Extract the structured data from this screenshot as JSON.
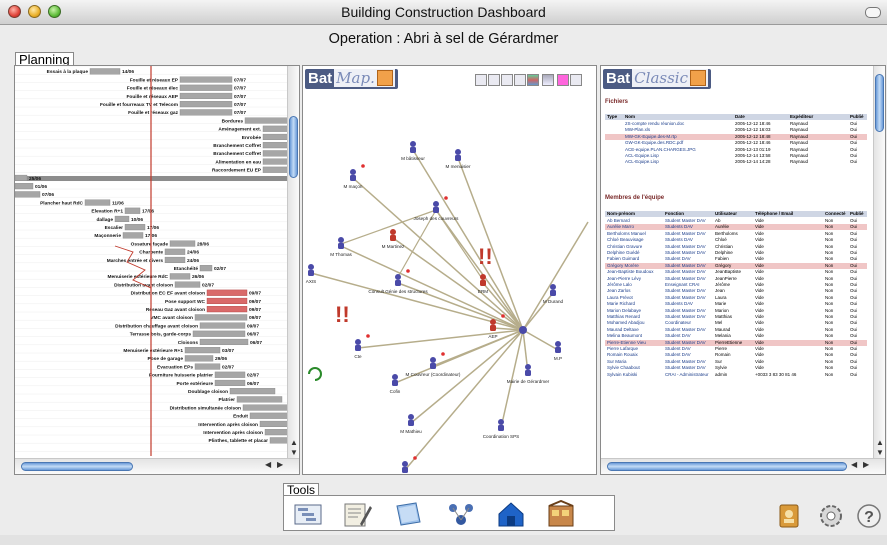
{
  "window": {
    "title": "Building Construction Dashboard"
  },
  "operation_title": "Operation : Abri à sel de Gérardmer",
  "planning": {
    "label": "Planning",
    "tasks": [
      {
        "name": "Essais à la plaque",
        "date": "14/06"
      },
      {
        "name": "Fouille et réseaux EP",
        "date": "07/07"
      },
      {
        "name": "Fouille et réseaux élec",
        "date": "07/07"
      },
      {
        "name": "Fouille et réseaux AEP",
        "date": "07/07"
      },
      {
        "name": "Fouille et fourreaux TV et Telecom",
        "date": "07/07"
      },
      {
        "name": "Fouille et réseaux gaz",
        "date": "07/07"
      },
      {
        "name": "Bordures",
        "date": "15/07"
      },
      {
        "name": "Aménagement ext.",
        "date": ""
      },
      {
        "name": "Enrobée",
        "date": ""
      },
      {
        "name": "Branchement Coffret",
        "date": ""
      },
      {
        "name": "Branchement Coffret",
        "date": ""
      },
      {
        "name": "Alimentation en eau",
        "date": ""
      },
      {
        "name": "Raccordement EU EP",
        "date": ""
      },
      {
        "name": "",
        "date": "25/06"
      },
      {
        "name": "",
        "date": "01/06"
      },
      {
        "name": "x pour dallage",
        "date": "07/06"
      },
      {
        "name": "Plancher haut RdC",
        "date": "11/06"
      },
      {
        "name": "Elevation R+1",
        "date": "17/06"
      },
      {
        "name": "dallage",
        "date": "10/06"
      },
      {
        "name": "Escalier",
        "date": "17/06"
      },
      {
        "name": "Maçonnerie",
        "date": "17/06"
      },
      {
        "name": "Ossature façade",
        "date": "28/06"
      },
      {
        "name": "Charpente",
        "date": "24/06"
      },
      {
        "name": "Marches entrée et divers",
        "date": "24/06"
      },
      {
        "name": "Etanchéité",
        "date": "02/07"
      },
      {
        "name": "Menuiserie extérieure RdC",
        "date": "26/06"
      },
      {
        "name": "Distribution avant cloison",
        "date": "02/07"
      },
      {
        "name": "Distribution EC EF avant cloison",
        "date": "09/07"
      },
      {
        "name": "Pose support WC",
        "date": "09/07"
      },
      {
        "name": "Réseau Gaz avant cloison",
        "date": "09/07"
      },
      {
        "name": "VMC avant cloison",
        "date": "09/07"
      },
      {
        "name": "Distribution chauffage avant cloison",
        "date": "09/07"
      },
      {
        "name": "Terrasse bois, garde-corps",
        "date": "06/07"
      },
      {
        "name": "Cloisons",
        "date": "06/07"
      },
      {
        "name": "Menuiserie extérieure R+1",
        "date": "03/07"
      },
      {
        "name": "Pose de garage",
        "date": "29/06"
      },
      {
        "name": "Evacuation EPs",
        "date": "02/07"
      },
      {
        "name": "Fourniture huisserie platrier",
        "date": "02/07"
      },
      {
        "name": "Porte extérieure",
        "date": "06/07"
      },
      {
        "name": "Doublage cloison",
        "date": ""
      },
      {
        "name": "Platrier",
        "date": ""
      },
      {
        "name": "Distribution simultanée cloison",
        "date": ""
      },
      {
        "name": "Enduit",
        "date": ""
      },
      {
        "name": "Intervention après cloison",
        "date": ""
      },
      {
        "name": "Intervention après cloison",
        "date": ""
      },
      {
        "name": "Plinthes, tablette et placar",
        "date": ""
      }
    ]
  },
  "batmap": {
    "logo_main": "Bat",
    "logo_sub": "Map.",
    "alerts": [
      "!!",
      "!!"
    ],
    "nodes": [
      "M maçon",
      "M bâtisseur",
      "M menuisier",
      "Joseph des couvreurs",
      "M Thomas",
      "M Martinez",
      "Consult Génie des structures",
      "ERM",
      "M Durand",
      "AEP",
      "M.P",
      "Mairie de Gérardmer",
      "M Couvreur (Coordinateur)",
      "Coordination SPS",
      "M Mathieu",
      "Cte",
      "Cofin",
      "AXIS",
      "M Dupont"
    ]
  },
  "batclassic": {
    "logo_main": "Bat",
    "logo_sub": "Classic",
    "files_title": "Fichiers",
    "files_headers": [
      "Type",
      "Nom",
      "Date",
      "Expéditeur",
      "Publié"
    ],
    "files": [
      [
        "",
        "2S-compte rendu réunion.doc",
        "2005-12-12 18:46",
        "Raynaud",
        "Oui"
      ],
      [
        "",
        "MW-Plan.xls",
        "2005-12-12 16:03",
        "Raynaud",
        "Oui"
      ],
      [
        "",
        "MW-GK-Equipe.des-M.rtp",
        "2005-12-12 18:48",
        "Raynaud",
        "Oui"
      ],
      [
        "",
        "GW-GK-Equipe.des.RDC.pdf",
        "2005-12-12 18:46",
        "Raynaud",
        "Oui"
      ],
      [
        "",
        "ACE-equipe.PLAN.CHARGES.JPG",
        "2005-12-13 01:19",
        "Raynaud",
        "Oui"
      ],
      [
        "",
        "ACL-Equipe.Lisp",
        "2005-12-14 13:58",
        "Raynaud",
        "Oui"
      ],
      [
        "",
        "ACL-Equipe.Lisp",
        "2005-12-14 14:28",
        "Raynaud",
        "Oui"
      ]
    ],
    "members_title": "Membres de l'équipe",
    "members_headers": [
      "Nom-prénom",
      "Fonction",
      "Utilisateur",
      "Téléphone / Email",
      "Connecté",
      "Publié"
    ],
    "members": [
      [
        "Ab Bernard",
        "Student Master DAV",
        "Ab",
        "Vide",
        "Non",
        "Oui"
      ],
      [
        "Aurélie Marro",
        "Students DAV",
        "Aurélie",
        "Vide",
        "Non",
        "Oui"
      ],
      [
        "Bertholoms Manuel",
        "Student Master DAV",
        "Bertholoms",
        "Vide",
        "Non",
        "Oui"
      ],
      [
        "Chloé Beauvisage",
        "Students DAV",
        "Chloé",
        "Vide",
        "Non",
        "Oui"
      ],
      [
        "Christian Gravure",
        "Student Master DAV",
        "Christian",
        "Vide",
        "Non",
        "Oui"
      ],
      [
        "Delphine Guédé",
        "Student Master DAV",
        "Delphine",
        "Vide",
        "Non",
        "Oui"
      ],
      [
        "Fabien Guimard",
        "Student DAV",
        "Fabien",
        "Vide",
        "Non",
        "Oui"
      ],
      [
        "Grégory Morère",
        "Student Master DAV",
        "Grégory",
        "Vide",
        "Non",
        "Oui"
      ],
      [
        "Jean-Baptiste Boudoux",
        "Student Master DAV",
        "JeanBaptiste",
        "Vide",
        "Non",
        "Oui"
      ],
      [
        "Jean-Pierre Lévy",
        "Student Master DAV",
        "JeanPierre",
        "Vide",
        "Non",
        "Oui"
      ],
      [
        "Jérôme Lalo",
        "Enseignant CRAI",
        "Jérôme",
        "Vide",
        "Non",
        "Oui"
      ],
      [
        "Jean Zarlos",
        "Student Master DAV",
        "Jean",
        "Vide",
        "Non",
        "Oui"
      ],
      [
        "Laura Prévot",
        "Student Master DAV",
        "Laura",
        "Vide",
        "Non",
        "Oui"
      ],
      [
        "Marie Richard",
        "Students DAV",
        "Marie",
        "Vide",
        "Non",
        "Oui"
      ],
      [
        "Marion Delabaye",
        "Student Master DAV",
        "Marion",
        "Vide",
        "Non",
        "Oui"
      ],
      [
        "Matthias Renard",
        "Student Master DAV",
        "Matthias",
        "Vide",
        "Non",
        "Oui"
      ],
      [
        "Mohamed Abadjou",
        "Coordinateur",
        "Mel",
        "Vide",
        "Non",
        "Oui"
      ],
      [
        "Maurad Deltaxe",
        "Student Master DAV",
        "Maurad",
        "Vide",
        "Non",
        "Oui"
      ],
      [
        "Melina Beaumont",
        "Student DAV",
        "Melania",
        "Vide",
        "Non",
        "Oui"
      ],
      [
        "Pierre-Etienne Vieu",
        "Student Master DAV",
        "PierreEtienne",
        "Vide",
        "Non",
        "Oui"
      ],
      [
        "Pierre Lafarque",
        "Student DAV",
        "Pierre",
        "Vide",
        "Non",
        "Oui"
      ],
      [
        "Romain Rouaix",
        "Student DAV",
        "Romain",
        "Vide",
        "Non",
        "Oui"
      ],
      [
        "Sur Maria",
        "Student Master DAV",
        "Sur",
        "Vide",
        "Non",
        "Oui"
      ],
      [
        "Sylvie Chaabout",
        "Student Master DAV",
        "Sylvie",
        "Vide",
        "Non",
        "Oui"
      ],
      [
        "Sylvain Kubiski",
        "CRAI - Administrateur",
        "admin",
        "+0033 3 83 30 81 46",
        "Non",
        "Oui"
      ]
    ]
  },
  "tools": {
    "label": "Tools"
  }
}
